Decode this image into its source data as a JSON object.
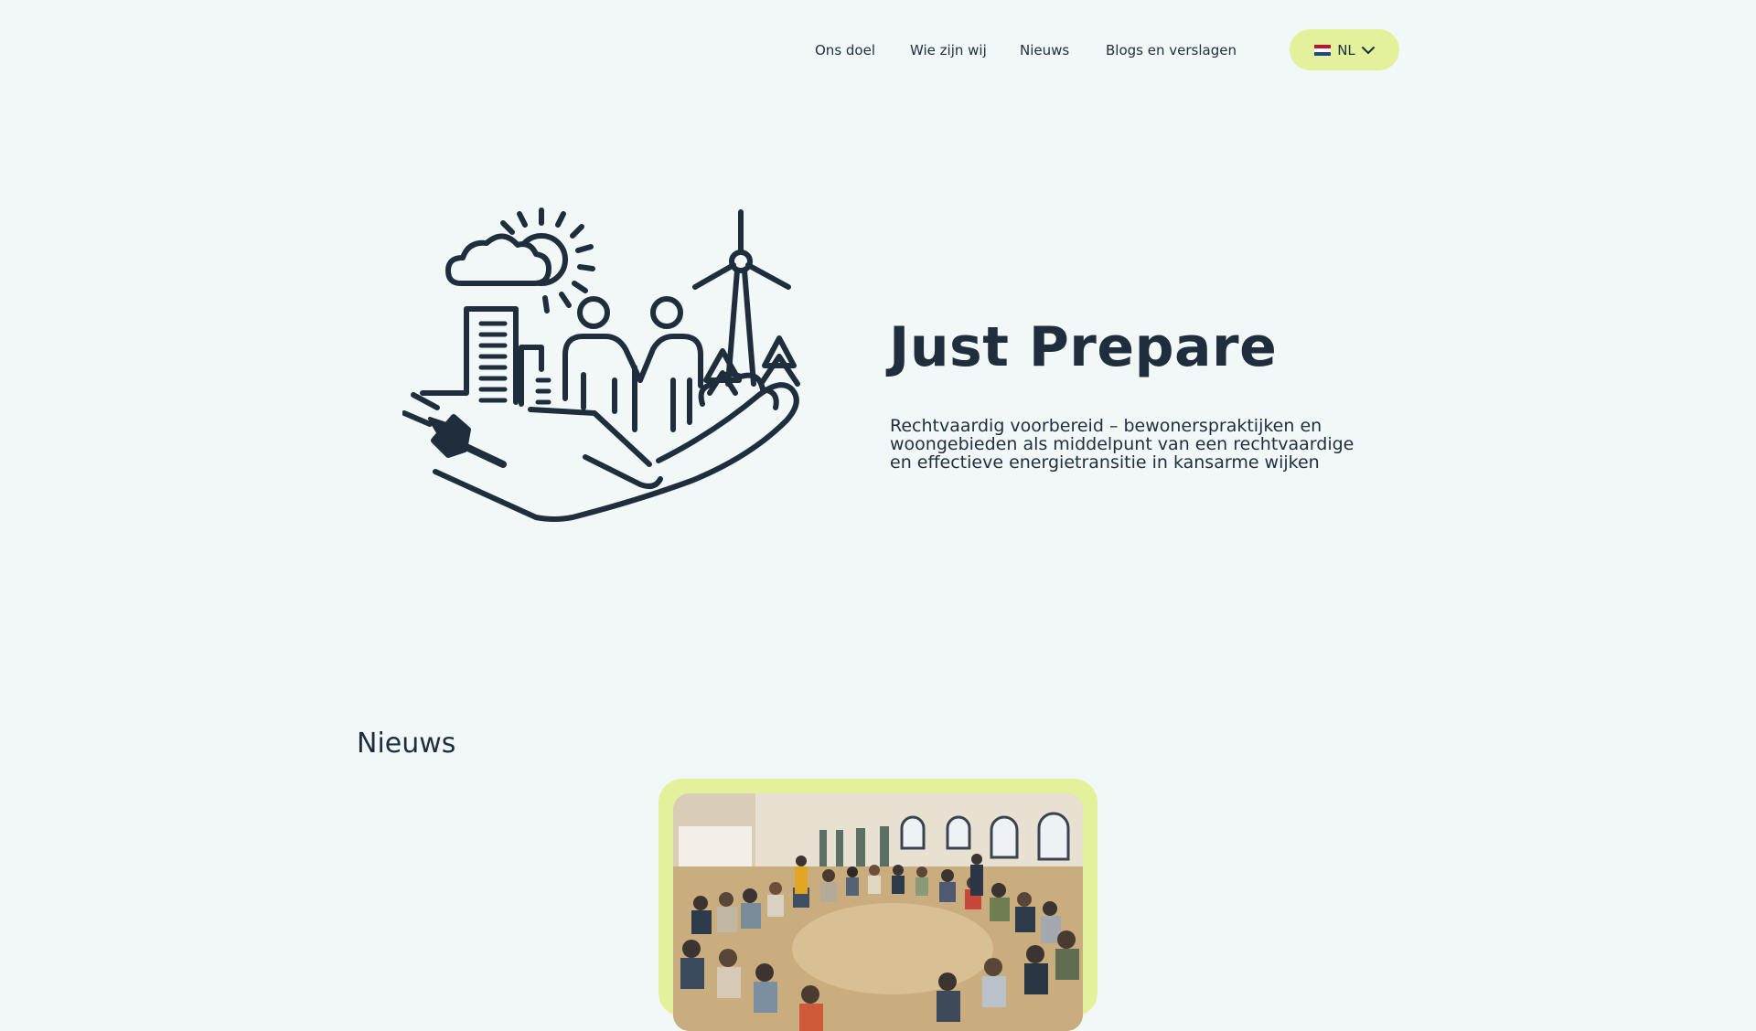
{
  "nav": {
    "links": [
      "Ons doel",
      "Wie zijn wij",
      "Nieuws",
      "Blogs en verslagen"
    ],
    "language": {
      "label": "NL",
      "flag": "netherlands-flag-icon",
      "chevron": "chevron-down-icon"
    }
  },
  "hero": {
    "title": "Just Prepare",
    "subtitle": "Rechtvaardig voorbereid – bewonerspraktijken en woongebieden als middelpunt van een rechtvaardige en effectieve energietransitie in kansarme wijken",
    "illustration": "hand-holding-city-people-windmill-sun-plug-icon"
  },
  "news": {
    "heading": "Nieuws",
    "card_image": "group-meeting-photo"
  },
  "colors": {
    "background": "#f2f8f8",
    "text": "#1f2d3d",
    "accent": "#e3f29a"
  }
}
